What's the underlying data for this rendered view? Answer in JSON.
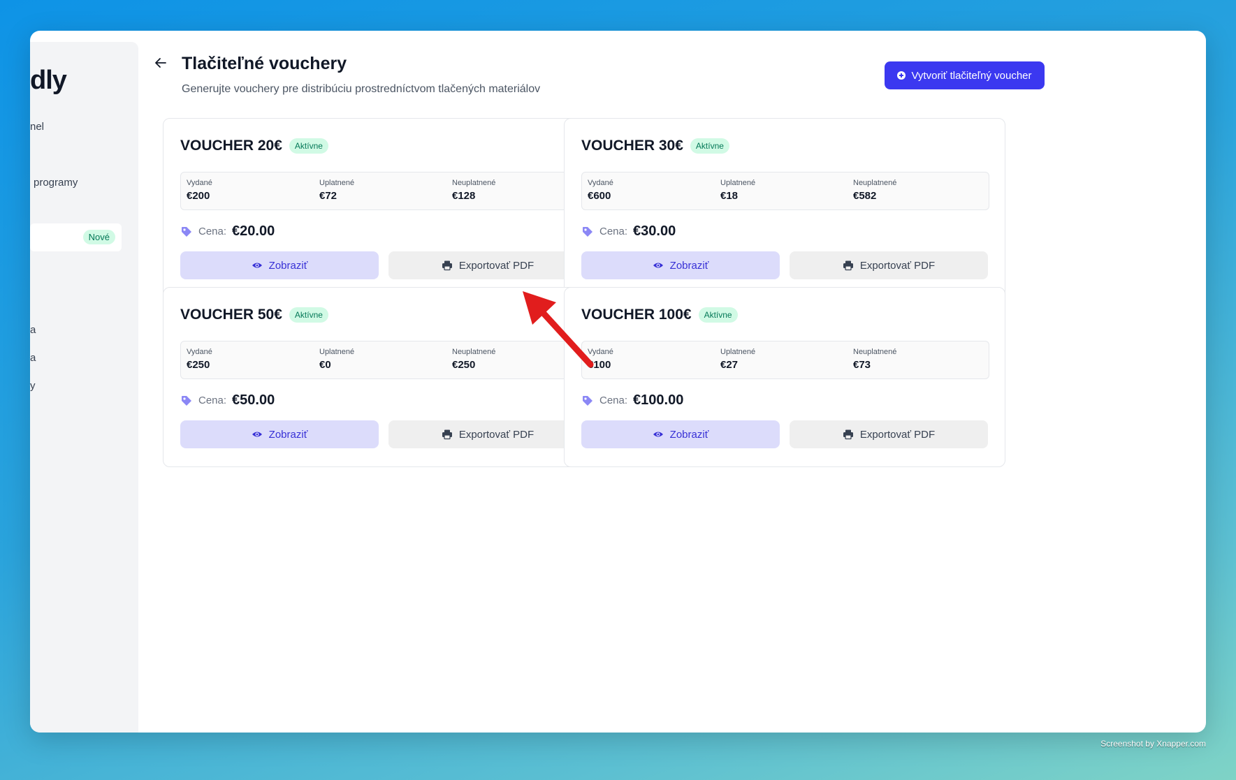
{
  "sidebar": {
    "brand": "dly",
    "items": [
      {
        "label": "nel"
      },
      {
        "label": "programy"
      },
      {
        "label": "a"
      },
      {
        "label": "a"
      },
      {
        "label": "y"
      }
    ],
    "active_badge": "Nové"
  },
  "header": {
    "title": "Tlačiteľné vouchery",
    "subtitle": "Generujte vouchery pre distribúciu prostredníctvom tlačených materiálov",
    "create_label": "Vytvoriť tlačiteľný voucher"
  },
  "stat_labels": {
    "issued": "Vydané",
    "redeemed": "Uplatnené",
    "unredeemed": "Neuplatnené"
  },
  "price_label": "Cena:",
  "view_label": "Zobraziť",
  "export_label": "Exportovať PDF",
  "vouchers": [
    {
      "title": "VOUCHER 20€",
      "status": "Aktívne",
      "issued": "€200",
      "redeemed": "€72",
      "unredeemed": "€128",
      "price": "€20.00"
    },
    {
      "title": "VOUCHER 30€",
      "status": "Aktívne",
      "issued": "€600",
      "redeemed": "€18",
      "unredeemed": "€582",
      "price": "€30.00"
    },
    {
      "title": "VOUCHER 50€",
      "status": "Aktívne",
      "issued": "€250",
      "redeemed": "€0",
      "unredeemed": "€250",
      "price": "€50.00"
    },
    {
      "title": "VOUCHER 100€",
      "status": "Aktívne",
      "issued": "€100",
      "redeemed": "€27",
      "unredeemed": "€73",
      "price": "€100.00"
    }
  ],
  "colors": {
    "accent": "#3b38f0",
    "status_green": "#047857",
    "arrow": "#e11d1d"
  },
  "watermark": "Screenshot by Xnapper.com"
}
